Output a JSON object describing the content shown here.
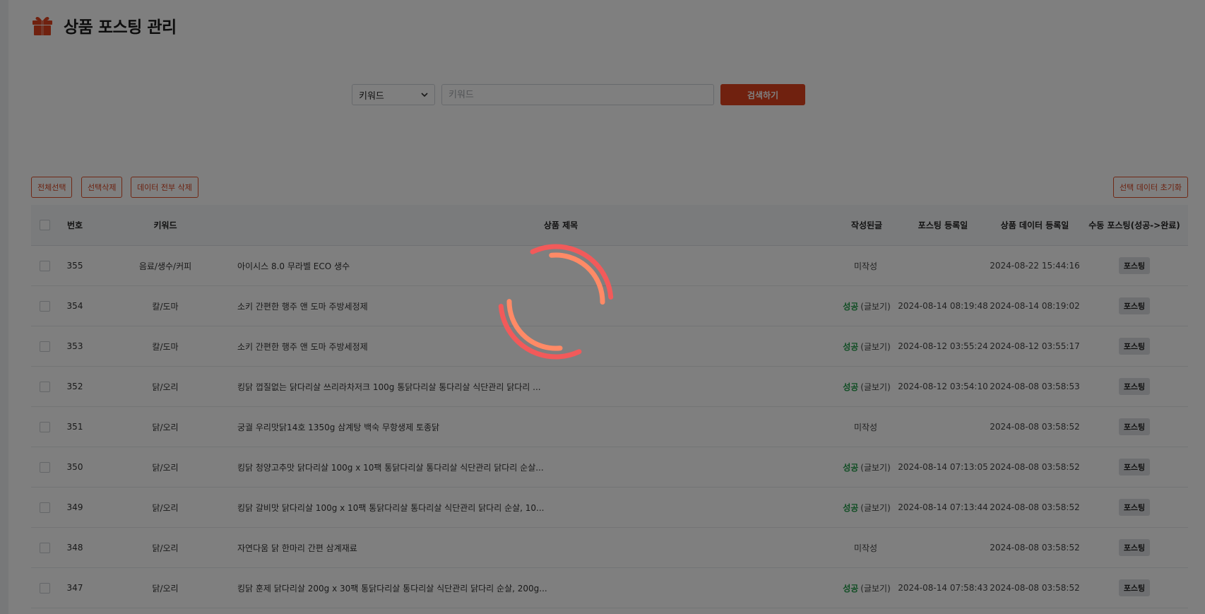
{
  "header": {
    "title": "상품 포스팅 관리",
    "icon": "gift-icon"
  },
  "search": {
    "select_value": "키워드",
    "input_placeholder": "키워드",
    "button_label": "검색하기"
  },
  "actions": {
    "select_all": "전체선택",
    "delete_selected": "선택삭제",
    "delete_all_data": "데이터 전부 삭제",
    "reset_selected": "선택 데이터 초기화"
  },
  "table": {
    "headers": {
      "number": "번호",
      "keyword": "키워드",
      "title": "상품 제목",
      "status": "작성된글",
      "posting_date": "포스팅 등록일",
      "data_date": "상품 데이터 등록일",
      "manual": "수동 포스팅(성공->완료)"
    },
    "rows": [
      {
        "number": "355",
        "keyword": "음료/생수/커피",
        "title": "아이시스 8.0 무라벨 ECO 생수",
        "status": "미작성",
        "status_link": "",
        "posting_date": "",
        "data_date": "2024-08-22 15:44:16",
        "action": "포스팅"
      },
      {
        "number": "354",
        "keyword": "칼/도마",
        "title": "소키 간편한 행주 앤 도마 주방세정제",
        "status": "성공",
        "status_link": "(글보기)",
        "posting_date": "2024-08-14 08:19:48",
        "data_date": "2024-08-14 08:19:02",
        "action": "포스팅"
      },
      {
        "number": "353",
        "keyword": "칼/도마",
        "title": "소키 간편한 행주 앤 도마 주방세정제",
        "status": "성공",
        "status_link": "(글보기)",
        "posting_date": "2024-08-12 03:55:24",
        "data_date": "2024-08-12 03:55:17",
        "action": "포스팅"
      },
      {
        "number": "352",
        "keyword": "닭/오리",
        "title": "킹닭 껍질없는 닭다리살 쓰리라차저크 100g 통닭다리살 통다리살 식단관리 닭다리 ...",
        "status": "성공",
        "status_link": "(글보기)",
        "posting_date": "2024-08-12 03:54:10",
        "data_date": "2024-08-08 03:58:53",
        "action": "포스팅"
      },
      {
        "number": "351",
        "keyword": "닭/오리",
        "title": "궁궐 우리맛닭14호 1350g 삼계탕 백숙 무항생제 토종닭",
        "status": "미작성",
        "status_link": "",
        "posting_date": "",
        "data_date": "2024-08-08 03:58:52",
        "action": "포스팅"
      },
      {
        "number": "350",
        "keyword": "닭/오리",
        "title": "킹닭 청양고추맛 닭다리살 100g x 10팩 통닭다리살 통다리살 식단관리 닭다리 순살...",
        "status": "성공",
        "status_link": "(글보기)",
        "posting_date": "2024-08-14 07:13:05",
        "data_date": "2024-08-08 03:58:52",
        "action": "포스팅"
      },
      {
        "number": "349",
        "keyword": "닭/오리",
        "title": "킹닭 갈비맛 닭다리살 100g x 10팩 통닭다리살 통다리살 식단관리 닭다리 순살, 10...",
        "status": "성공",
        "status_link": "(글보기)",
        "posting_date": "2024-08-14 07:13:44",
        "data_date": "2024-08-08 03:58:52",
        "action": "포스팅"
      },
      {
        "number": "348",
        "keyword": "닭/오리",
        "title": "자연다움 닭 한마리 간편 삼계재료",
        "status": "미작성",
        "status_link": "",
        "posting_date": "",
        "data_date": "2024-08-08 03:58:52",
        "action": "포스팅"
      },
      {
        "number": "347",
        "keyword": "닭/오리",
        "title": "킹닭 훈제 닭다리살 200g x 30팩 통닭다리살 통다리살 식단관리 닭다리 순살, 200g...",
        "status": "성공",
        "status_link": "(글보기)",
        "posting_date": "2024-08-14 07:58:43",
        "data_date": "2024-08-08 03:58:52",
        "action": "포스팅"
      }
    ]
  },
  "overlay": {
    "spinner_icon": "loading-spinner-icon"
  },
  "colors": {
    "accent": "#e0431f",
    "success": "#1e9b46",
    "spinner_primary": "#f25a5a",
    "spinner_secondary": "#ff8a66"
  }
}
